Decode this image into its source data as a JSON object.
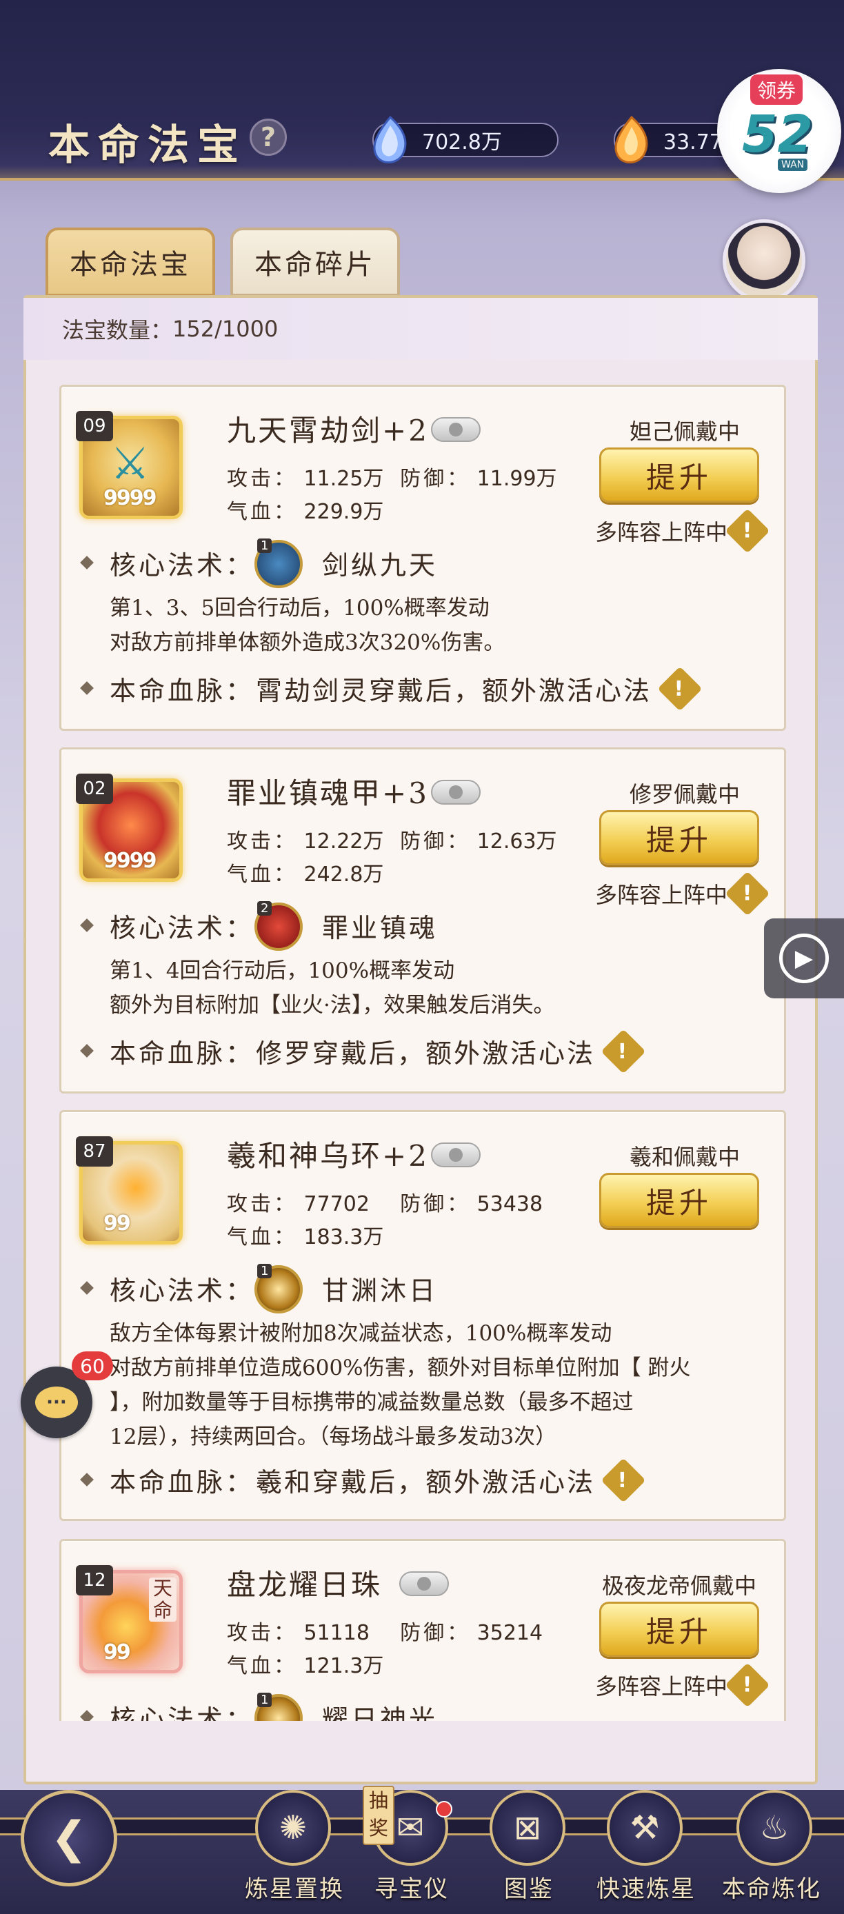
{
  "header": {
    "title": "本命法宝",
    "help_symbol": "?",
    "currency_1": {
      "icon": "blue-crystal-icon",
      "value": "702.8万"
    },
    "currency_2": {
      "icon": "flame-crystal-icon",
      "value": "33.77万"
    }
  },
  "ad_badge": {
    "coupon": "领券",
    "brand": "52",
    "brand_sub": "WAN"
  },
  "tabs": [
    {
      "label": "本命法宝",
      "active": true
    },
    {
      "label": "本命碎片",
      "active": false
    }
  ],
  "count": {
    "label": "法宝数量：",
    "value": "152/1000"
  },
  "labels": {
    "attack": "攻击：",
    "defense": "防御：",
    "hp": "气血：",
    "core_skill": "核心法术：",
    "bloodline": "本命血脉："
  },
  "items": [
    {
      "level": "09",
      "stars": "9999",
      "name": "九天霄劫剑+2",
      "attack": "11.25万",
      "defense": "11.99万",
      "hp": "229.9万",
      "wearer": "妲己佩戴中",
      "upgrade": "提升",
      "multi_team": "多阵容上阵中",
      "skill_num": "1",
      "skill_name": "剑纵九天",
      "desc_lines": [
        "第1、3、5回合行动后，100%概率发动",
        "对敌方前排单体额外造成3次320%伤害。"
      ],
      "bloodline": "霄劫剑灵穿戴后，额外激活心法"
    },
    {
      "level": "02",
      "stars": "9999",
      "name": "罪业镇魂甲+3",
      "attack": "12.22万",
      "defense": "12.63万",
      "hp": "242.8万",
      "wearer": "修罗佩戴中",
      "upgrade": "提升",
      "multi_team": "多阵容上阵中",
      "skill_num": "2",
      "skill_name": "罪业镇魂",
      "desc_lines": [
        "第1、4回合行动后，100%概率发动",
        "额外为目标附加【业火·法】，效果触发后消失。"
      ],
      "bloodline": "修罗穿戴后，额外激活心法"
    },
    {
      "level": "87",
      "stars": "99",
      "name": "羲和神乌环+2",
      "attack": "77702",
      "defense": "53438",
      "hp": "183.3万",
      "wearer": "羲和佩戴中",
      "upgrade": "提升",
      "skill_num": "1",
      "skill_name": "甘渊沐日",
      "desc_lines": [
        "敌方全体每累计被附加8次减益状态，100%概率发动",
        "对敌方前排单位造成600%伤害，额外对目标单位附加【 跗火",
        "】，附加数量等于目标携带的减益数量总数（最多不超过",
        "12层），持续两回合。（每场战斗最多发动3次）"
      ],
      "bloodline": "羲和穿戴后，额外激活心法"
    },
    {
      "level": "12",
      "stars": "99",
      "tianming": "天命",
      "name": "盘龙耀日珠",
      "attack": "51118",
      "defense": "35214",
      "hp": "121.3万",
      "wearer": "极夜龙帝佩戴中",
      "upgrade": "提升",
      "multi_team": "多阵容上阵中",
      "skill_num": "1",
      "skill_name": "耀日神光"
    }
  ],
  "floating": {
    "chat_badge": "60"
  },
  "bottom_nav": [
    {
      "label": "炼星置换",
      "icon": "star-swap-icon"
    },
    {
      "label": "寻宝仪",
      "icon": "treasure-scroll-icon",
      "tag": "抽奖"
    },
    {
      "label": "图鉴",
      "icon": "codex-icon"
    },
    {
      "label": "快速炼星",
      "icon": "hammer-icon"
    },
    {
      "label": "本命炼化",
      "icon": "cauldron-icon"
    }
  ],
  "colors": {
    "accent_gold": "#c9a86a",
    "header_bg": "#2c2b55",
    "button_gold": "#f3cf55"
  }
}
